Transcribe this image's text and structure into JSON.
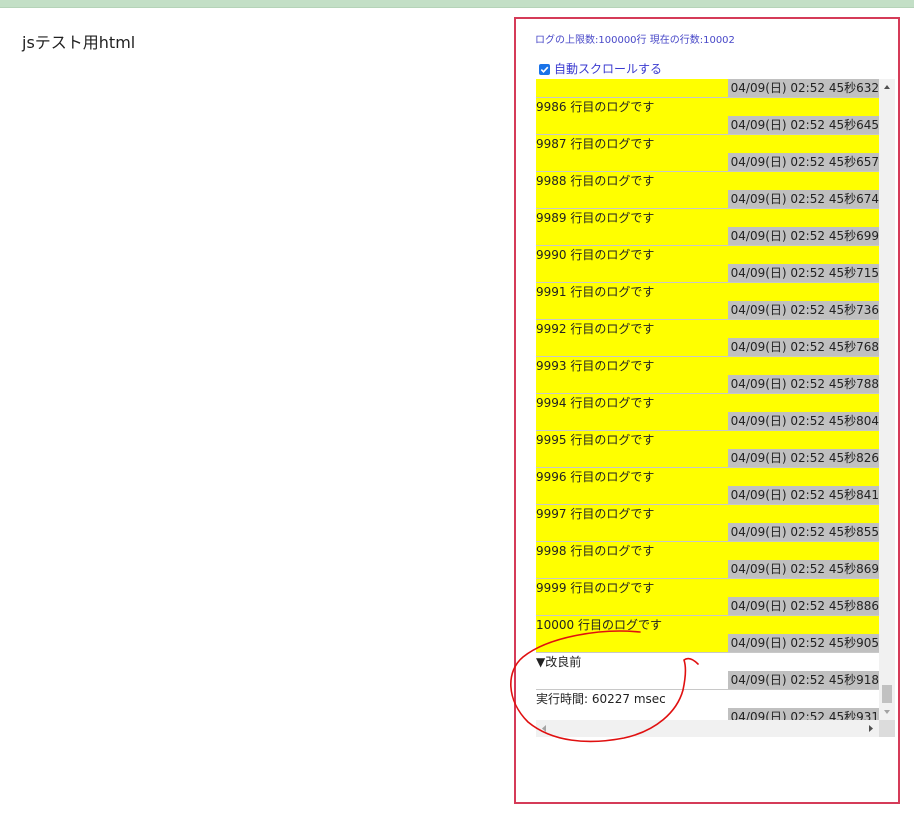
{
  "page": {
    "title": "jsテスト用html"
  },
  "log_panel": {
    "status_text": "ログの上限数:100000行 現在の行数:10002",
    "autoscroll": {
      "label": "自動スクロールする",
      "checked": true
    },
    "partial_top_timestamp": "04/09(日) 02:52 45秒632",
    "entries": [
      {
        "message": "9986 行目のログです",
        "timestamp": "04/09(日) 02:52 45秒645",
        "highlighted": true
      },
      {
        "message": "9987 行目のログです",
        "timestamp": "04/09(日) 02:52 45秒657",
        "highlighted": true
      },
      {
        "message": "9988 行目のログです",
        "timestamp": "04/09(日) 02:52 45秒674",
        "highlighted": true
      },
      {
        "message": "9989 行目のログです",
        "timestamp": "04/09(日) 02:52 45秒699",
        "highlighted": true
      },
      {
        "message": "9990 行目のログです",
        "timestamp": "04/09(日) 02:52 45秒715",
        "highlighted": true
      },
      {
        "message": "9991 行目のログです",
        "timestamp": "04/09(日) 02:52 45秒736",
        "highlighted": true
      },
      {
        "message": "9992 行目のログです",
        "timestamp": "04/09(日) 02:52 45秒768",
        "highlighted": true
      },
      {
        "message": "9993 行目のログです",
        "timestamp": "04/09(日) 02:52 45秒788",
        "highlighted": true
      },
      {
        "message": "9994 行目のログです",
        "timestamp": "04/09(日) 02:52 45秒804",
        "highlighted": true
      },
      {
        "message": "9995 行目のログです",
        "timestamp": "04/09(日) 02:52 45秒826",
        "highlighted": true
      },
      {
        "message": "9996 行目のログです",
        "timestamp": "04/09(日) 02:52 45秒841",
        "highlighted": true
      },
      {
        "message": "9997 行目のログです",
        "timestamp": "04/09(日) 02:52 45秒855",
        "highlighted": true
      },
      {
        "message": "9998 行目のログです",
        "timestamp": "04/09(日) 02:52 45秒869",
        "highlighted": true
      },
      {
        "message": "9999 行目のログです",
        "timestamp": "04/09(日) 02:52 45秒886",
        "highlighted": true
      },
      {
        "message": "10000 行目のログです",
        "timestamp": "04/09(日) 02:52 45秒905",
        "highlighted": true
      },
      {
        "message": "▼改良前",
        "timestamp": "04/09(日) 02:52 45秒918",
        "highlighted": false
      },
      {
        "message": "実行時間: 60227 msec",
        "timestamp": "04/09(日) 02:52 45秒931",
        "highlighted": false
      }
    ]
  },
  "colors": {
    "highlight": "#ffff00",
    "timestamp_bg": "#c0c0c0",
    "panel_border": "#d53b58",
    "annotation": "#e01010"
  },
  "icons": {
    "checkbox": "checkmark-icon",
    "scroll_up": "arrow-up-icon",
    "scroll_down": "arrow-down-icon",
    "scroll_left": "arrow-left-icon",
    "scroll_right": "arrow-right-icon"
  }
}
